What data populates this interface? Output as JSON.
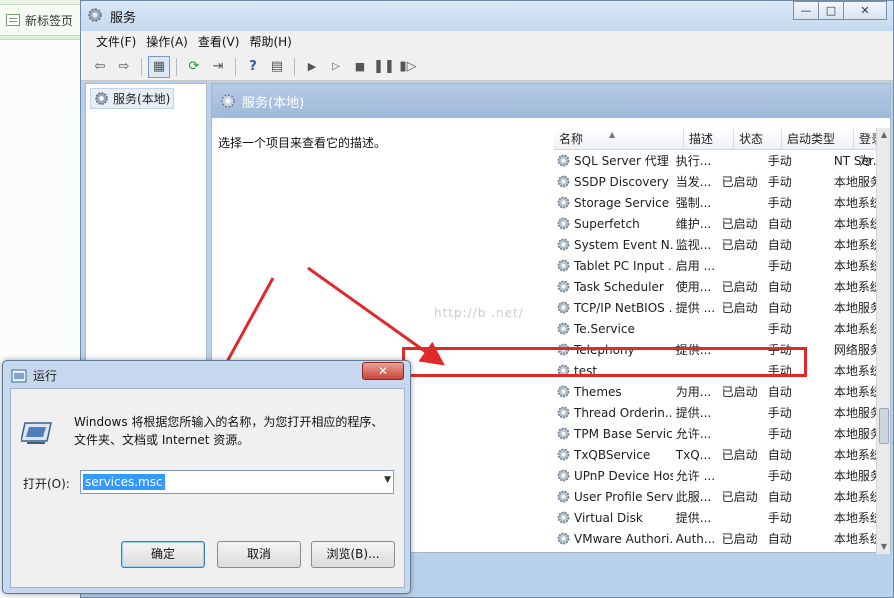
{
  "browser": {
    "tab_label": "新标签页"
  },
  "services_window": {
    "title": "服务",
    "controls": {
      "minimize": "—",
      "maximize": "□",
      "close": "✕"
    },
    "menu": [
      "文件(F)",
      "操作(A)",
      "查看(V)",
      "帮助(H)"
    ],
    "tree_item": "服务(本地)",
    "content_header": "服务(本地)",
    "description_hint": "选择一个项目来查看它的描述。",
    "columns": [
      "名称",
      "描述",
      "状态",
      "启动类型",
      "登录为"
    ],
    "rows": [
      {
        "name": "SQL Server 代理 ...",
        "desc": "执行...",
        "status": "",
        "startup": "手动",
        "logon": "NT Ser..."
      },
      {
        "name": "SSDP Discovery",
        "desc": "当发...",
        "status": "已启动",
        "startup": "手动",
        "logon": "本地服务"
      },
      {
        "name": "Storage Service",
        "desc": "强制...",
        "status": "",
        "startup": "手动",
        "logon": "本地系统"
      },
      {
        "name": "Superfetch",
        "desc": "维护...",
        "status": "已启动",
        "startup": "自动",
        "logon": "本地系统"
      },
      {
        "name": "System Event N...",
        "desc": "监视...",
        "status": "已启动",
        "startup": "自动",
        "logon": "本地系统"
      },
      {
        "name": "Tablet PC Input ...",
        "desc": "启用 ...",
        "status": "",
        "startup": "手动",
        "logon": "本地系统"
      },
      {
        "name": "Task Scheduler",
        "desc": "使用...",
        "status": "已启动",
        "startup": "自动",
        "logon": "本地系统"
      },
      {
        "name": "TCP/IP NetBIOS ...",
        "desc": "提供 ...",
        "status": "已启动",
        "startup": "自动",
        "logon": "本地服务"
      },
      {
        "name": "Te.Service",
        "desc": "",
        "status": "",
        "startup": "手动",
        "logon": "本地系统"
      },
      {
        "name": "Telephony",
        "desc": "提供...",
        "status": "",
        "startup": "手动",
        "logon": "网络服务"
      },
      {
        "name": "test",
        "desc": "",
        "status": "",
        "startup": "手动",
        "logon": "本地系统"
      },
      {
        "name": "Themes",
        "desc": "为用...",
        "status": "已启动",
        "startup": "自动",
        "logon": "本地系统"
      },
      {
        "name": "Thread Orderin...",
        "desc": "提供...",
        "status": "",
        "startup": "手动",
        "logon": "本地服务"
      },
      {
        "name": "TPM Base Servic...",
        "desc": "允许...",
        "status": "",
        "startup": "手动",
        "logon": "本地服务"
      },
      {
        "name": "TxQBService",
        "desc": "TxQ...",
        "status": "已启动",
        "startup": "自动",
        "logon": "本地系统"
      },
      {
        "name": "UPnP Device Host",
        "desc": "允许 ...",
        "status": "",
        "startup": "手动",
        "logon": "本地服务"
      },
      {
        "name": "User Profile Serv...",
        "desc": "此服...",
        "status": "已启动",
        "startup": "自动",
        "logon": "本地系统"
      },
      {
        "name": "Virtual Disk",
        "desc": "提供...",
        "status": "",
        "startup": "手动",
        "logon": "本地系统"
      },
      {
        "name": "VMware Authori...",
        "desc": "Auth...",
        "status": "已启动",
        "startup": "自动",
        "logon": "本地系统"
      }
    ]
  },
  "watermark": "http://b                 .net/",
  "run_dialog": {
    "title": "运行",
    "close": "✕",
    "message": "Windows 将根据您所输入的名称，为您打开相应的程序、文件夹、文档或 Internet 资源。",
    "open_label": "打开(O):",
    "open_value": "services.msc",
    "ok_label": "确定",
    "cancel_label": "取消",
    "browse_label": "浏览(B)..."
  },
  "colors": {
    "annotation_red": "#e02a2a",
    "selection_blue": "#3399ff",
    "header_blue": "#9fb9d9"
  }
}
